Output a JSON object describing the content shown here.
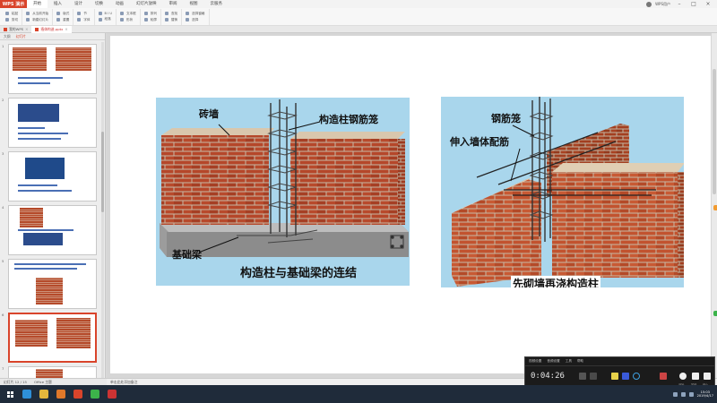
{
  "app": {
    "badge": "WPS 演示",
    "menu": [
      "开始",
      "插入",
      "设计",
      "切换",
      "动画",
      "幻灯片放映",
      "审阅",
      "视图",
      "云服务"
    ],
    "active_menu": 0,
    "user": "WPS用户"
  },
  "ribbon": {
    "groups": [
      {
        "top": "粘贴",
        "bottom": "剪切"
      },
      {
        "top": "从当前开始",
        "bottom": "新建幻灯片"
      },
      {
        "top": "版式",
        "bottom": "重置"
      },
      {
        "top": "节",
        "bottom": "字体"
      },
      {
        "top": "B I U",
        "bottom": "段落"
      },
      {
        "top": "文本框",
        "bottom": "形状"
      },
      {
        "top": "排列",
        "bottom": "轮廓"
      },
      {
        "top": "查找",
        "bottom": "替换"
      },
      {
        "top": "选择窗格",
        "bottom": "选择"
      }
    ]
  },
  "tabs": [
    {
      "label": "我的WPS",
      "active": false
    },
    {
      "label": "墙体构造.pptx",
      "active": true
    }
  ],
  "sidebar": {
    "tabs": [
      "大纲",
      "幻灯片"
    ],
    "active_tab": 1,
    "slide_numbers": [
      "1",
      "2",
      "3",
      "4",
      "5",
      "6",
      "7"
    ],
    "selected_index": 5
  },
  "slide": {
    "left": {
      "callouts": {
        "wall": "砖墙",
        "cage": "构造柱钢筋笼",
        "beam": "基础梁"
      },
      "caption": "构造柱与基础梁的连结"
    },
    "right": {
      "callouts": {
        "cage": "钢筋笼",
        "bars": "伸入墙体配筋"
      },
      "caption": "先砌墙再浇构造柱"
    }
  },
  "notes": {
    "placeholder": "单击此处添加备注"
  },
  "status": {
    "slide_info": "幻灯片 12 / 15",
    "theme": "Office 主题"
  },
  "recorder": {
    "menu": [
      "视频设置",
      "音频设置",
      "工具",
      "帮助"
    ],
    "timer": "0:04:26",
    "labels": [
      "开始",
      "暂停",
      "停止"
    ]
  },
  "taskbar": {
    "time": "15:03",
    "date": "2019/4/17"
  },
  "colors": {
    "accent": "#d9442b",
    "taskbar": "#1f2b3a",
    "brick": "#b54a2a",
    "sky": "#a9d6ec"
  }
}
